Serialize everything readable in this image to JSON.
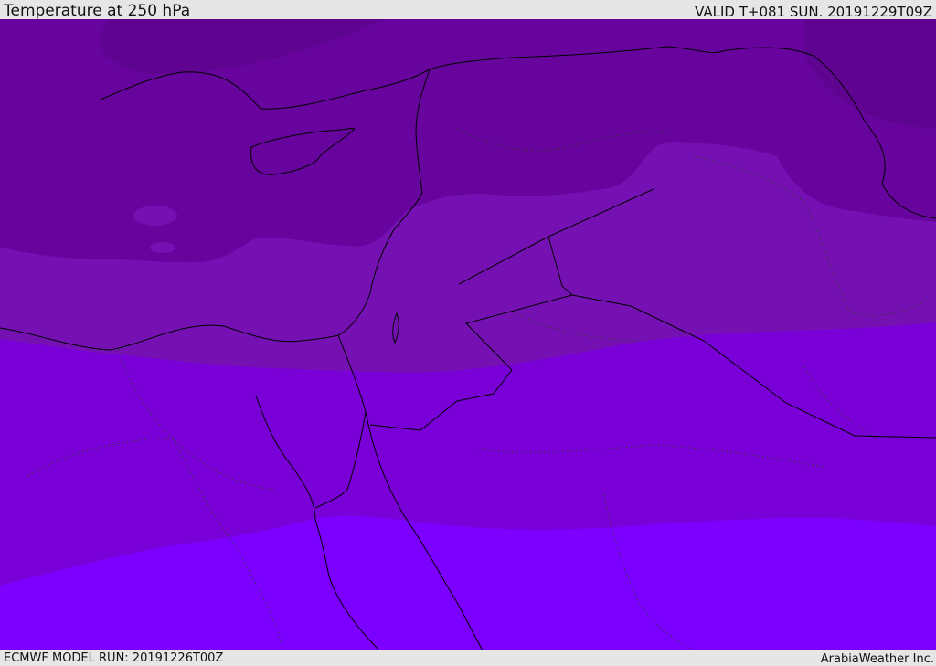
{
  "header": {
    "title": "Temperature at 250 hPa",
    "valid": "VALID T+081 SUN. 20191229T09Z"
  },
  "footer": {
    "model_run": "ECMWF MODEL RUN: 20191226T00Z",
    "credit": "ArabiaWeather Inc."
  },
  "palette": {
    "band_coldest": "#5e0490",
    "band_cold": "#68049e",
    "band_mid": "#7511b3",
    "band_warm": "#7a00d8",
    "band_warmest": "#7b00ff",
    "coastline": "#000000"
  }
}
